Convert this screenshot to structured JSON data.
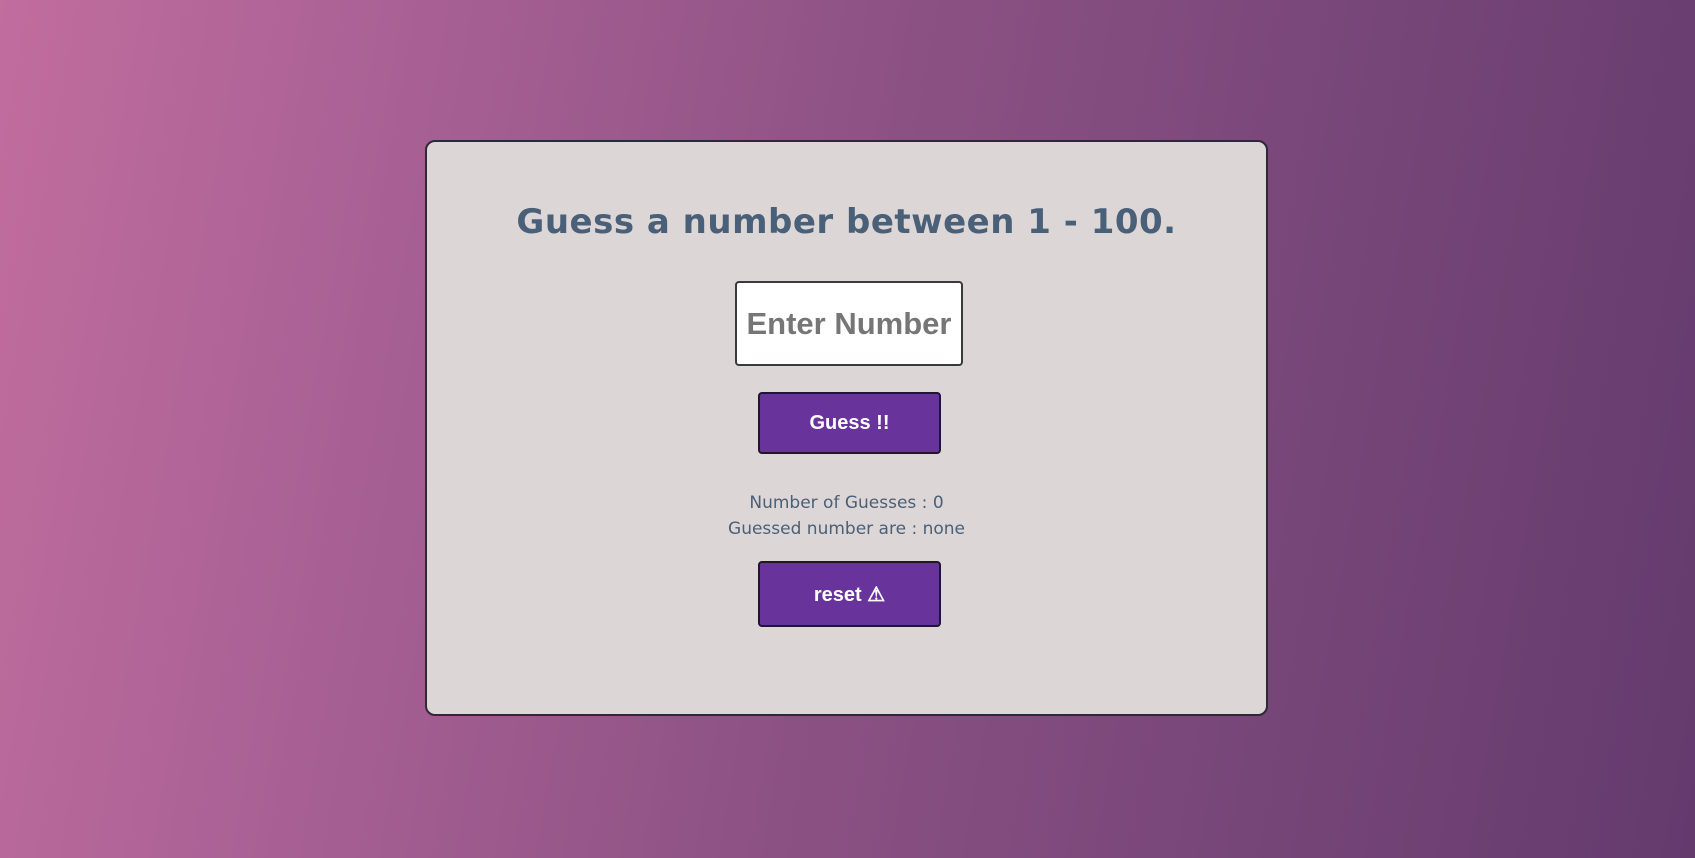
{
  "game": {
    "title": "Guess a number between 1 - 100.",
    "input_placeholder": "Enter Number",
    "input_value": "",
    "guess_button_label": "Guess !!",
    "stats": {
      "guess_count_label": "Number of Guesses : 0",
      "guessed_numbers_label": "Guessed number are : none"
    },
    "reset_button_label": "reset ⚠"
  },
  "colors": {
    "background_gradient_start": "#c16d9e",
    "background_gradient_end": "#643a6d",
    "card_background": "#dcd7d6",
    "text_color": "#4a5f78",
    "button_color": "#68349b"
  }
}
